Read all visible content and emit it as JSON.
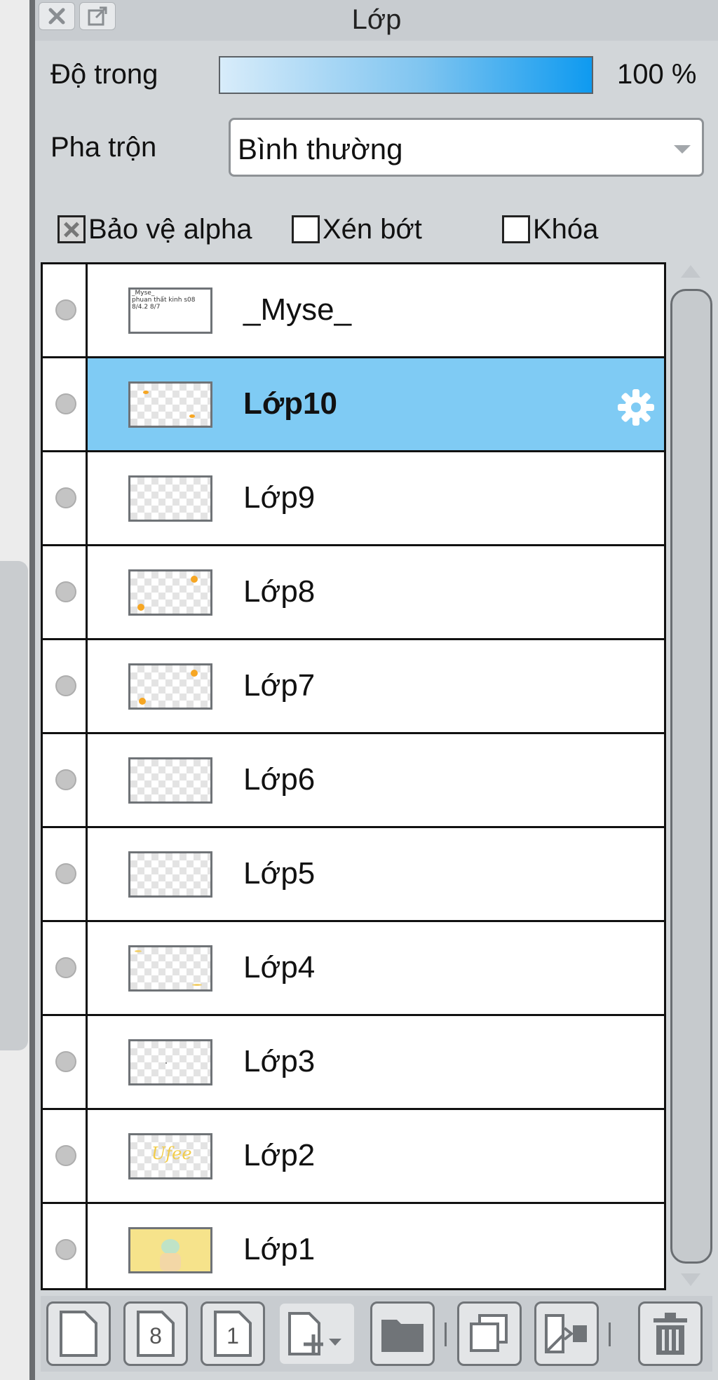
{
  "panel": {
    "title": "Lớp",
    "opacity_label": "Độ trong",
    "opacity_value": "100 %",
    "opacity_level": 1.0,
    "blend_label": "Pha trộn",
    "blend_value": "Bình thường",
    "protect_alpha_label": "Bảo vệ alpha",
    "protect_alpha_checked": true,
    "clip_label": "Xén bớt",
    "clip_checked": false,
    "lock_label": "Khóa",
    "lock_checked": false
  },
  "layers": [
    {
      "name": "_Myse_",
      "selected": false
    },
    {
      "name": "Lớp10",
      "selected": true
    },
    {
      "name": "Lớp9",
      "selected": false
    },
    {
      "name": "Lớp8",
      "selected": false
    },
    {
      "name": "Lớp7",
      "selected": false
    },
    {
      "name": "Lớp6",
      "selected": false
    },
    {
      "name": "Lớp5",
      "selected": false
    },
    {
      "name": "Lớp4",
      "selected": false
    },
    {
      "name": "Lớp3",
      "selected": false
    },
    {
      "name": "Lớp2",
      "selected": false
    },
    {
      "name": "Lớp1",
      "selected": false
    }
  ],
  "thumb_text": {
    "myse": "_Myse_\nphuan thất kinh s08\n8/4.2 8/7",
    "lop2": "Ufee"
  },
  "toolbar": {
    "add_layer_8_label": "8",
    "add_layer_1_label": "1"
  },
  "colors": {
    "selected_row": "#7fcbf4",
    "opacity_bar_end": "#0e9af0"
  }
}
